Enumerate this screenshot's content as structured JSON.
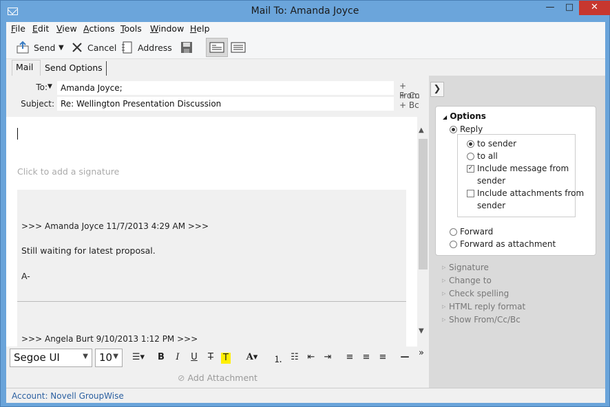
{
  "window": {
    "title": "Mail To: Amanda Joyce",
    "minimize": "—",
    "maximize": "□",
    "close": "✕"
  },
  "menu": [
    "File",
    "Edit",
    "View",
    "Actions",
    "Tools",
    "Window",
    "Help"
  ],
  "menu_underline": [
    "F",
    "E",
    "V",
    "A",
    "T",
    "W",
    "H"
  ],
  "toolbar": {
    "send": "Send",
    "cancel": "Cancel",
    "address": "Address"
  },
  "tabs": {
    "mail": "Mail",
    "send_options": "Send Options"
  },
  "header": {
    "to_label": "To:",
    "to_value": "Amanda Joyce;",
    "subject_label": "Subject:",
    "subject_value": "Re: Wellington Presentation Discussion",
    "from_link": "From",
    "cc_link": "Cc",
    "bc_link": "Bc"
  },
  "body": {
    "signature_prompt": "Click to add a signature",
    "quote1_header": ">>> Amanda Joyce 11/7/2013 4:29 AM >>>",
    "quote1_line1": "Still  waiting for latest proposal.",
    "quote1_line2": "A-",
    "quote2_header": ">>> Angela Burt 9/10/2013 1:12 PM >>>"
  },
  "format": {
    "font": "Segoe UI",
    "size": "10"
  },
  "attachment": "Add Attachment",
  "status": "Account: Novell GroupWise",
  "options": {
    "title": "Options",
    "reply": "Reply",
    "to_sender": "to sender",
    "to_all": "to all",
    "include_message": "Include message from",
    "include_message_2": "sender",
    "include_attach": "Include attachments from",
    "include_attach_2": "sender",
    "forward": "Forward",
    "forward_attach": "Forward as attachment"
  },
  "side_links": [
    "Signature",
    "Change to",
    "Check spelling",
    "HTML reply format",
    "Show From/Cc/Bc"
  ]
}
